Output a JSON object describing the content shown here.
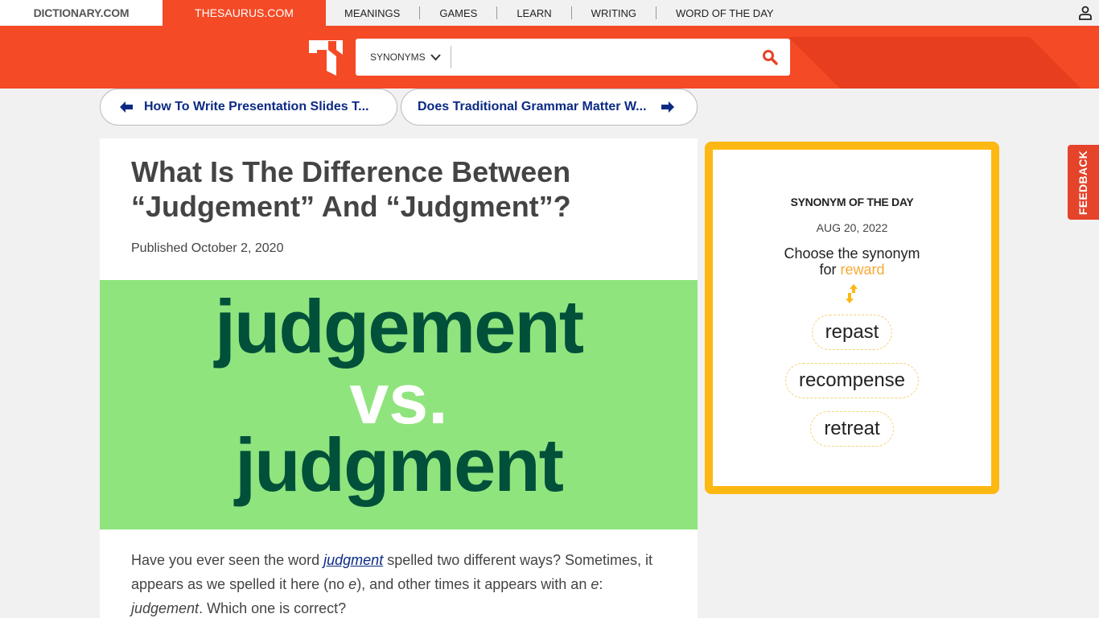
{
  "topnav": {
    "sites": [
      {
        "label": "DICTIONARY.COM",
        "active": false
      },
      {
        "label": "THESAURUS.COM",
        "active": true
      }
    ],
    "links": [
      "MEANINGS",
      "GAMES",
      "LEARN",
      "WRITING",
      "WORD OF THE DAY"
    ],
    "user_icon": "user-icon"
  },
  "header": {
    "logo_icon": "thesaurus-logo-icon",
    "search": {
      "mode_label": "SYNONYMS",
      "value": "",
      "placeholder": "",
      "search_icon": "search-icon"
    }
  },
  "pagination": {
    "prev_label": "How To Write Presentation Slides T...",
    "next_label": "Does Traditional Grammar Matter W..."
  },
  "article": {
    "title": "What Is The Difference Between “Judgement” And “Judgment”?",
    "published": "Published October 2, 2020",
    "hero": {
      "word1": "judgement",
      "vs": "vs.",
      "word2": "judgment"
    },
    "intro": {
      "p1": "Have you ever seen the word ",
      "link": "judgment",
      "p2": " spelled two different ways? Sometimes, it appears as we spelled it here (no ",
      "e1": "e",
      "p3": "), and other times it appears with an ",
      "e2": "e",
      "p4": ": ",
      "italic_word": "judgement",
      "p5": ". Which one is correct?"
    }
  },
  "synonym_of_the_day": {
    "title": "SYNONYM OF THE DAY",
    "date": "AUG 20, 2022",
    "prompt": "Choose the synonym",
    "prompt_for": "for ",
    "word": "reward",
    "options": [
      "repast",
      "recompense",
      "retreat"
    ],
    "accent_color": "#fdb813"
  },
  "feedback_label": "FEEDBACK",
  "colors": {
    "brand": "#f44a25",
    "link": "#0b2a83",
    "hero_bg": "#90e47e",
    "hero_text": "#00503a"
  }
}
